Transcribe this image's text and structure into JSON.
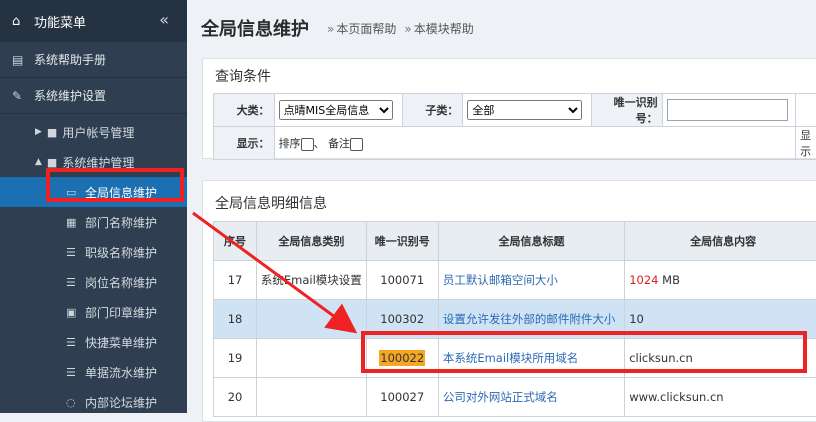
{
  "sidebar": {
    "title": "功能菜单",
    "collapse_icon": "«",
    "items": [
      {
        "label": "系统帮助手册",
        "icon": "book-icon"
      },
      {
        "label": "系统维护设置",
        "icon": "wrench-icon"
      }
    ],
    "groups": [
      {
        "label": "用户帐号管理",
        "expanded": false
      },
      {
        "label": "系统维护管理",
        "expanded": true
      }
    ],
    "leaves": [
      {
        "label": "全局信息维护",
        "icon": "monitor-icon",
        "active": true
      },
      {
        "label": "部门名称维护",
        "icon": "building-icon"
      },
      {
        "label": "职级名称维护",
        "icon": "list-icon"
      },
      {
        "label": "岗位名称维护",
        "icon": "list-icon"
      },
      {
        "label": "部门印章维护",
        "icon": "id-card-icon"
      },
      {
        "label": "快捷菜单维护",
        "icon": "list-icon"
      },
      {
        "label": "单据流水维护",
        "icon": "list-icon"
      },
      {
        "label": "内部论坛维护",
        "icon": "comments-icon"
      }
    ]
  },
  "header": {
    "title": "全局信息维护",
    "help_links": [
      "本页面帮助",
      "本模块帮助"
    ]
  },
  "query": {
    "title": "查询条件",
    "category_label": "大类：",
    "category_value": "点晴MIS全局信息",
    "subclass_label": "子类：",
    "subclass_value": "全部",
    "id_label": "唯一识别号：",
    "id_value": "",
    "display_label": "显示：",
    "sort_label": "排序",
    "sep": "、",
    "note_label": "备注",
    "display_right": "显示"
  },
  "detail": {
    "title": "全局信息明细信息",
    "columns": [
      "序号",
      "全局信息类别",
      "唯一识别号",
      "全局信息标题",
      "全局信息内容"
    ],
    "rows": [
      {
        "num": "17",
        "cat": "系统Email模块设置",
        "id": "100071",
        "title": "员工默认邮箱空间大小",
        "content_value": "1024",
        "content_unit": " MB"
      },
      {
        "num": "18",
        "cat": "",
        "id": "100302",
        "title": "设置允许发往外部的邮件附件大小",
        "content_value": "",
        "content_unit": "10"
      },
      {
        "num": "19",
        "cat": "",
        "id": "100022",
        "title": "本系统Email模块所用域名",
        "content_value": "",
        "content_unit": "clicksun.cn"
      },
      {
        "num": "20",
        "cat": "",
        "id": "100027",
        "title": "公司对外网站正式域名",
        "content_value": "",
        "content_unit": "www.clicksun.cn"
      }
    ]
  },
  "colors": {
    "sidebar_bg": "#2f3e50",
    "active": "#1c6fb0",
    "highlight": "#ee2222",
    "selected_row": "#cfe3f5",
    "code_highlight": "#f5a623"
  }
}
